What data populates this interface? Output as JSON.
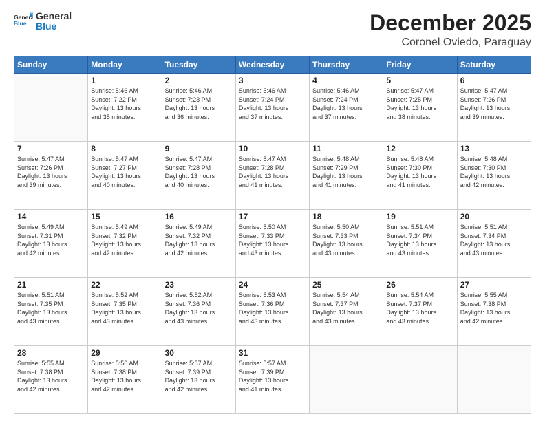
{
  "logo": {
    "general": "General",
    "blue": "Blue"
  },
  "title": {
    "month": "December 2025",
    "location": "Coronel Oviedo, Paraguay"
  },
  "weekdays": [
    "Sunday",
    "Monday",
    "Tuesday",
    "Wednesday",
    "Thursday",
    "Friday",
    "Saturday"
  ],
  "weeks": [
    [
      {
        "day": "",
        "info": ""
      },
      {
        "day": "1",
        "info": "Sunrise: 5:46 AM\nSunset: 7:22 PM\nDaylight: 13 hours\nand 35 minutes."
      },
      {
        "day": "2",
        "info": "Sunrise: 5:46 AM\nSunset: 7:23 PM\nDaylight: 13 hours\nand 36 minutes."
      },
      {
        "day": "3",
        "info": "Sunrise: 5:46 AM\nSunset: 7:24 PM\nDaylight: 13 hours\nand 37 minutes."
      },
      {
        "day": "4",
        "info": "Sunrise: 5:46 AM\nSunset: 7:24 PM\nDaylight: 13 hours\nand 37 minutes."
      },
      {
        "day": "5",
        "info": "Sunrise: 5:47 AM\nSunset: 7:25 PM\nDaylight: 13 hours\nand 38 minutes."
      },
      {
        "day": "6",
        "info": "Sunrise: 5:47 AM\nSunset: 7:26 PM\nDaylight: 13 hours\nand 39 minutes."
      }
    ],
    [
      {
        "day": "7",
        "info": "Sunrise: 5:47 AM\nSunset: 7:26 PM\nDaylight: 13 hours\nand 39 minutes."
      },
      {
        "day": "8",
        "info": "Sunrise: 5:47 AM\nSunset: 7:27 PM\nDaylight: 13 hours\nand 40 minutes."
      },
      {
        "day": "9",
        "info": "Sunrise: 5:47 AM\nSunset: 7:28 PM\nDaylight: 13 hours\nand 40 minutes."
      },
      {
        "day": "10",
        "info": "Sunrise: 5:47 AM\nSunset: 7:28 PM\nDaylight: 13 hours\nand 41 minutes."
      },
      {
        "day": "11",
        "info": "Sunrise: 5:48 AM\nSunset: 7:29 PM\nDaylight: 13 hours\nand 41 minutes."
      },
      {
        "day": "12",
        "info": "Sunrise: 5:48 AM\nSunset: 7:30 PM\nDaylight: 13 hours\nand 41 minutes."
      },
      {
        "day": "13",
        "info": "Sunrise: 5:48 AM\nSunset: 7:30 PM\nDaylight: 13 hours\nand 42 minutes."
      }
    ],
    [
      {
        "day": "14",
        "info": "Sunrise: 5:49 AM\nSunset: 7:31 PM\nDaylight: 13 hours\nand 42 minutes."
      },
      {
        "day": "15",
        "info": "Sunrise: 5:49 AM\nSunset: 7:32 PM\nDaylight: 13 hours\nand 42 minutes."
      },
      {
        "day": "16",
        "info": "Sunrise: 5:49 AM\nSunset: 7:32 PM\nDaylight: 13 hours\nand 42 minutes."
      },
      {
        "day": "17",
        "info": "Sunrise: 5:50 AM\nSunset: 7:33 PM\nDaylight: 13 hours\nand 43 minutes."
      },
      {
        "day": "18",
        "info": "Sunrise: 5:50 AM\nSunset: 7:33 PM\nDaylight: 13 hours\nand 43 minutes."
      },
      {
        "day": "19",
        "info": "Sunrise: 5:51 AM\nSunset: 7:34 PM\nDaylight: 13 hours\nand 43 minutes."
      },
      {
        "day": "20",
        "info": "Sunrise: 5:51 AM\nSunset: 7:34 PM\nDaylight: 13 hours\nand 43 minutes."
      }
    ],
    [
      {
        "day": "21",
        "info": "Sunrise: 5:51 AM\nSunset: 7:35 PM\nDaylight: 13 hours\nand 43 minutes."
      },
      {
        "day": "22",
        "info": "Sunrise: 5:52 AM\nSunset: 7:35 PM\nDaylight: 13 hours\nand 43 minutes."
      },
      {
        "day": "23",
        "info": "Sunrise: 5:52 AM\nSunset: 7:36 PM\nDaylight: 13 hours\nand 43 minutes."
      },
      {
        "day": "24",
        "info": "Sunrise: 5:53 AM\nSunset: 7:36 PM\nDaylight: 13 hours\nand 43 minutes."
      },
      {
        "day": "25",
        "info": "Sunrise: 5:54 AM\nSunset: 7:37 PM\nDaylight: 13 hours\nand 43 minutes."
      },
      {
        "day": "26",
        "info": "Sunrise: 5:54 AM\nSunset: 7:37 PM\nDaylight: 13 hours\nand 43 minutes."
      },
      {
        "day": "27",
        "info": "Sunrise: 5:55 AM\nSunset: 7:38 PM\nDaylight: 13 hours\nand 42 minutes."
      }
    ],
    [
      {
        "day": "28",
        "info": "Sunrise: 5:55 AM\nSunset: 7:38 PM\nDaylight: 13 hours\nand 42 minutes."
      },
      {
        "day": "29",
        "info": "Sunrise: 5:56 AM\nSunset: 7:38 PM\nDaylight: 13 hours\nand 42 minutes."
      },
      {
        "day": "30",
        "info": "Sunrise: 5:57 AM\nSunset: 7:39 PM\nDaylight: 13 hours\nand 42 minutes."
      },
      {
        "day": "31",
        "info": "Sunrise: 5:57 AM\nSunset: 7:39 PM\nDaylight: 13 hours\nand 41 minutes."
      },
      {
        "day": "",
        "info": ""
      },
      {
        "day": "",
        "info": ""
      },
      {
        "day": "",
        "info": ""
      }
    ]
  ]
}
